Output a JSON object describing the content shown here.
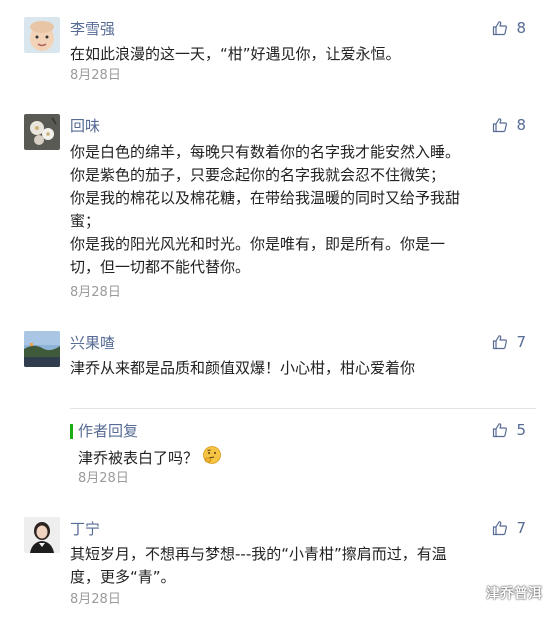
{
  "colors": {
    "name": "#576b95",
    "text": "#222222",
    "date": "#9b9b9b",
    "reply_bar": "#1aad19"
  },
  "comments": [
    {
      "name": "李雪强",
      "likes": "8",
      "lines": [
        "在如此浪漫的这一天，“柑”好遇见你，让爱永恒。"
      ],
      "date": "8月28日"
    },
    {
      "name": "回味",
      "likes": "8",
      "lines": [
        "你是白色的绵羊，每晚只有数着你的名字我才能安然入睡。",
        "你是紫色的茄子，只要念起你的名字我就会忍不住微笑；",
        "你是我的棉花以及棉花糖，在带给我温暖的同时又给予我甜",
        "蜜；",
        "你是我的阳光风光和时光。你是唯有，即是所有。你是一",
        "切，但一切都不能代替你。"
      ],
      "date": "8月28日"
    },
    {
      "name": "兴果喳",
      "likes": "7",
      "lines": [
        "津乔从来都是品质和颜值双爆！小心柑，柑心爱着你"
      ],
      "date": "",
      "reply": {
        "label": "作者回复",
        "likes": "5",
        "text": "津乔被表白了吗？",
        "emoji": "thinking-face",
        "date": "8月28日"
      }
    },
    {
      "name": "丁宁",
      "likes": "7",
      "lines": [
        "其短岁月，不想再与梦想---我的“小青柑”擦肩而过，有温",
        "度，更多“青”。"
      ],
      "date": "8月28日"
    }
  ],
  "watermark": {
    "text": "津乔普洱",
    "icon": "wechat-icon"
  }
}
